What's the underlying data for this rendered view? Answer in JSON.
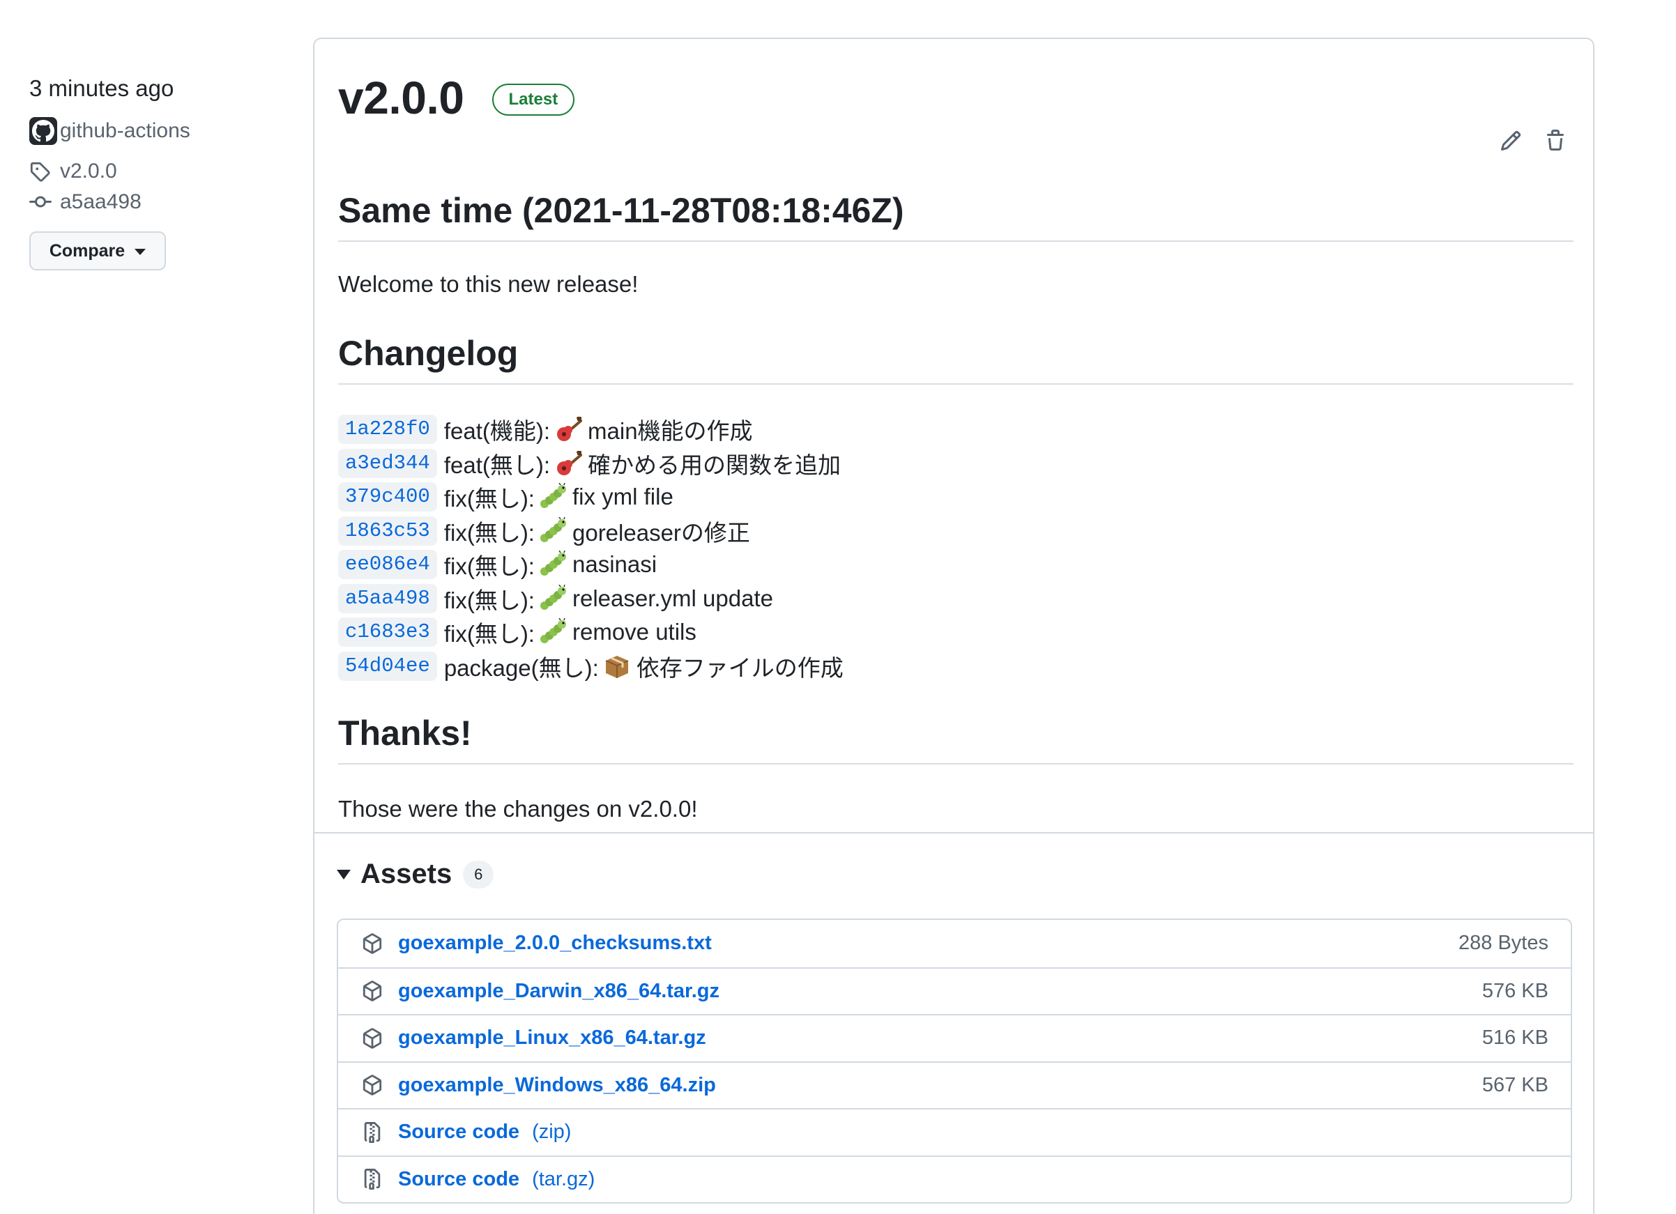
{
  "meta": {
    "time": "3 minutes ago",
    "author": "github-actions",
    "tag": "v2.0.0",
    "commit": "a5aa498",
    "compare_label": "Compare"
  },
  "release": {
    "title": "v2.0.0",
    "badge": "Latest",
    "edit_icon": "pencil-icon",
    "delete_icon": "trash-icon"
  },
  "body": {
    "heading1": "Same time (2021-11-28T08:18:46Z)",
    "welcome": "Welcome to this new release!",
    "heading2": "Changelog",
    "changelog": [
      {
        "sha": "1a228f0",
        "prefix": "feat(機能):",
        "emoji": "guitar",
        "text": "main機能の作成"
      },
      {
        "sha": "a3ed344",
        "prefix": "feat(無し):",
        "emoji": "guitar",
        "text": "確かめる用の関数を追加"
      },
      {
        "sha": "379c400",
        "prefix": "fix(無し):",
        "emoji": "caterpillar",
        "text": "fix yml file"
      },
      {
        "sha": "1863c53",
        "prefix": "fix(無し):",
        "emoji": "caterpillar",
        "text": "goreleaserの修正"
      },
      {
        "sha": "ee086e4",
        "prefix": "fix(無し):",
        "emoji": "caterpillar",
        "text": "nasinasi"
      },
      {
        "sha": "a5aa498",
        "prefix": "fix(無し):",
        "emoji": "caterpillar",
        "text": "releaser.yml update"
      },
      {
        "sha": "c1683e3",
        "prefix": "fix(無し):",
        "emoji": "caterpillar",
        "text": "remove utils"
      },
      {
        "sha": "54d04ee",
        "prefix": "package(無し):",
        "emoji": "package",
        "text": "依存ファイルの作成"
      }
    ],
    "heading3": "Thanks!",
    "closing": "Those were the changes on v2.0.0!"
  },
  "assets": {
    "title": "Assets",
    "count": "6",
    "items": [
      {
        "name": "goexample_2.0.0_checksums.txt",
        "kind": "",
        "size": "288 Bytes",
        "icon": "package-icon"
      },
      {
        "name": "goexample_Darwin_x86_64.tar.gz",
        "kind": "",
        "size": "576 KB",
        "icon": "package-icon"
      },
      {
        "name": "goexample_Linux_x86_64.tar.gz",
        "kind": "",
        "size": "516 KB",
        "icon": "package-icon"
      },
      {
        "name": "goexample_Windows_x86_64.zip",
        "kind": "",
        "size": "567 KB",
        "icon": "package-icon"
      },
      {
        "name": "Source code",
        "kind": "(zip)",
        "size": "",
        "icon": "file-zip-icon"
      },
      {
        "name": "Source code",
        "kind": "(tar.gz)",
        "size": "",
        "icon": "file-zip-icon"
      }
    ]
  },
  "colors": {
    "link": "#0969da",
    "latest_badge": "#1a7f37",
    "border": "#d1d9e0",
    "muted": "#59636e"
  }
}
